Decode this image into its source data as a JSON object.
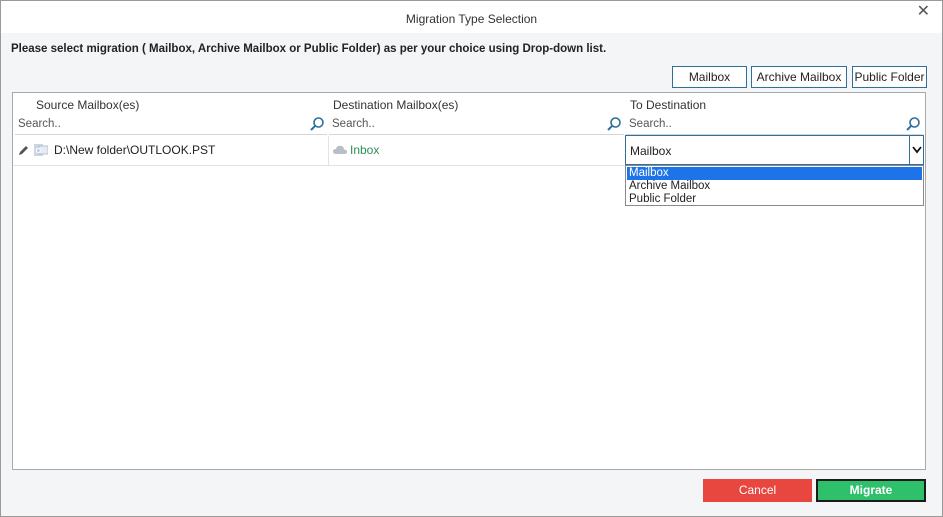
{
  "window": {
    "title": "Migration Type Selection",
    "close_icon": "close-icon"
  },
  "instruction": "Please select migration ( Mailbox, Archive Mailbox or Public Folder) as per your choice using Drop-down list.",
  "type_buttons": {
    "mailbox": "Mailbox",
    "archive": "Archive Mailbox",
    "public": "Public Folder"
  },
  "grid": {
    "columns": [
      "Source Mailbox(es)",
      "Destination Mailbox(es)",
      "To Destination"
    ],
    "search_placeholder": "Search..",
    "rows": [
      {
        "source": "D:\\New folder\\OUTLOOK.PST",
        "destination": "Inbox",
        "to_destination": "Mailbox"
      }
    ]
  },
  "dropdown": {
    "options": [
      "Mailbox",
      "Archive Mailbox",
      "Public Folder"
    ],
    "selected_index": 0
  },
  "footer": {
    "cancel": "Cancel",
    "migrate": "Migrate"
  },
  "colors": {
    "cancel": "#e8473f",
    "migrate": "#2fc06b",
    "accent": "#2f6f9c",
    "selection": "#1e73e8",
    "inbox_text": "#2e8b57"
  }
}
